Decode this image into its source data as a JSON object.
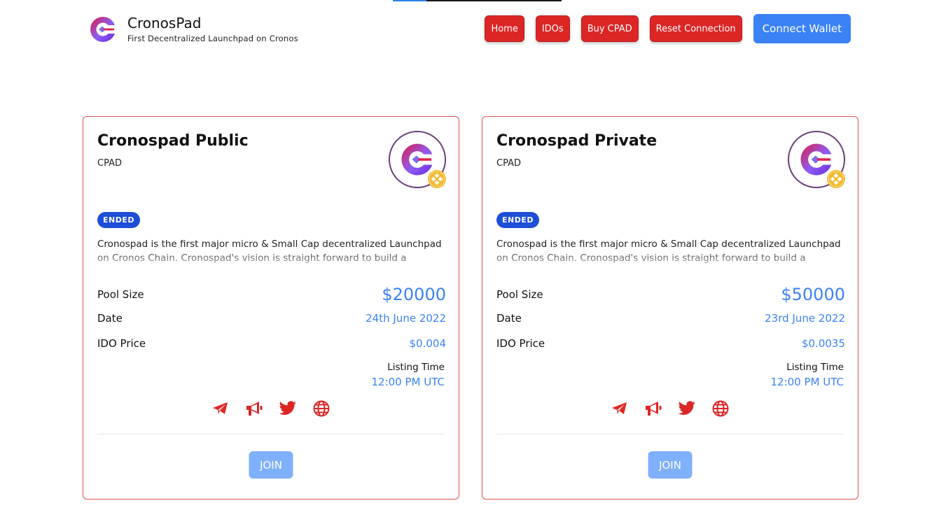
{
  "header": {
    "brand_name": "CronosPad",
    "brand_tagline": "First Decentralized Launchpad on Cronos",
    "nav": {
      "home": "Home",
      "idos": "IDOs",
      "buy": "Buy CPAD",
      "reset": "Reset Connection",
      "connect": "Connect Wallet"
    }
  },
  "page_loading": {
    "progress": 0.2
  },
  "colors": {
    "brand_red": "#dc2626",
    "connect_blue": "#3b82f6",
    "value_blue": "#3b82f6",
    "badge_blue": "#1d4ed8",
    "join_disabled": "#7fb0fb",
    "card_border": "#e05252"
  },
  "icons": {
    "logo": "cronospad-logo-icon",
    "chain": "binance-badge-icon",
    "socials": [
      "telegram-icon",
      "megaphone-icon",
      "twitter-icon",
      "globe-icon"
    ]
  },
  "pools": [
    {
      "title": "Cronospad Public",
      "symbol": "CPAD",
      "status": "ENDED",
      "description": "Cronospad is the first major micro & Small Cap decentralized Launchpad on Cronos Chain. Cronospad's vision is straight forward to build a decentralized",
      "pool_size_label": "Pool Size",
      "pool_size": "$20000",
      "date_label": "Date",
      "date": "24th June 2022",
      "price_label": "IDO Price",
      "price": "$0.004",
      "listing_label": "Listing Time",
      "listing_time": "12:00 PM UTC",
      "join": "JOIN"
    },
    {
      "title": "Cronospad Private",
      "symbol": "CPAD",
      "status": "ENDED",
      "description": "Cronospad is the first major micro & Small Cap decentralized Launchpad on Cronos Chain. Cronospad's vision is straight forward to build a decentralized",
      "pool_size_label": "Pool Size",
      "pool_size": "$50000",
      "date_label": "Date",
      "date": "23rd June 2022",
      "price_label": "IDO Price",
      "price": "$0.0035",
      "listing_label": "Listing Time",
      "listing_time": "12:00 PM UTC",
      "join": "JOIN"
    }
  ]
}
